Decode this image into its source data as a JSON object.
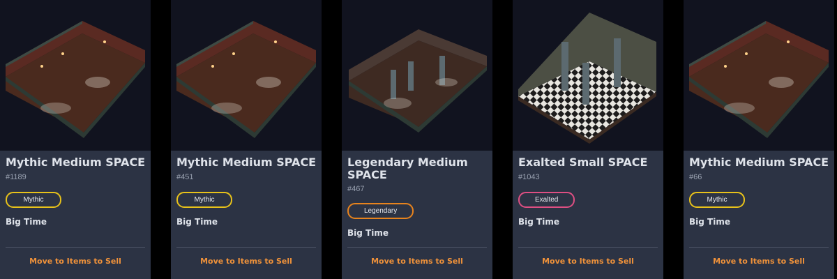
{
  "cards": [
    {
      "title": "Mythic Medium SPACE",
      "serial": "#1189",
      "rarity": "Mythic",
      "creator": "Big Time",
      "action": "Move to Items to Sell",
      "room": "wood"
    },
    {
      "title": "Mythic Medium SPACE",
      "serial": "#451",
      "rarity": "Mythic",
      "creator": "Big Time",
      "action": "Move to Items to Sell",
      "room": "wood"
    },
    {
      "title": "Legendary Medium SPACE",
      "serial": "#467",
      "rarity": "Legendary",
      "creator": "Big Time",
      "action": "Move to Items to Sell",
      "room": "pillars"
    },
    {
      "title": "Exalted Small SPACE",
      "serial": "#1043",
      "rarity": "Exalted",
      "creator": "Big Time",
      "action": "Move to Items to Sell",
      "room": "checker"
    },
    {
      "title": "Mythic Medium SPACE",
      "serial": "#66",
      "rarity": "Mythic",
      "creator": "Big Time",
      "action": "Move to Items to Sell",
      "room": "wood"
    }
  ],
  "colors": {
    "mythic": "#e8c21a",
    "legendary": "#e7831d",
    "exalted": "#df4f83",
    "action": "#f0923a",
    "card_bg": "#2c3344"
  }
}
